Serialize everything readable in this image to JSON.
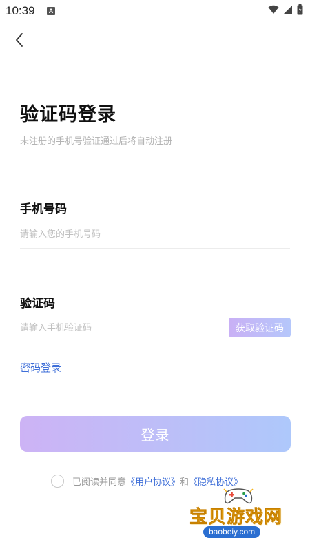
{
  "status_bar": {
    "time": "10:39",
    "notification_icon": "A"
  },
  "header": {
    "back_icon": "chevron-left-icon"
  },
  "title": "验证码登录",
  "subtitle": "未注册的手机号验证通过后将自动注册",
  "phone": {
    "label": "手机号码",
    "placeholder": "请输入您的手机号码",
    "value": ""
  },
  "code": {
    "label": "验证码",
    "placeholder": "请输入手机验证码",
    "value": "",
    "button_label": "获取验证码"
  },
  "password_login_label": "密码登录",
  "login_button_label": "登录",
  "agreement": {
    "prefix": "已阅读并同意",
    "user_agreement": "《用户协议》",
    "and": "和",
    "privacy_policy": "《隐私协议》",
    "checked": false
  },
  "watermark": {
    "text": "宝贝游戏网",
    "url": "baobeiy.com"
  },
  "colors": {
    "link": "#3f6fd8",
    "button_gradient_start": "#cdb3f5",
    "button_gradient_end": "#aec8fb"
  }
}
